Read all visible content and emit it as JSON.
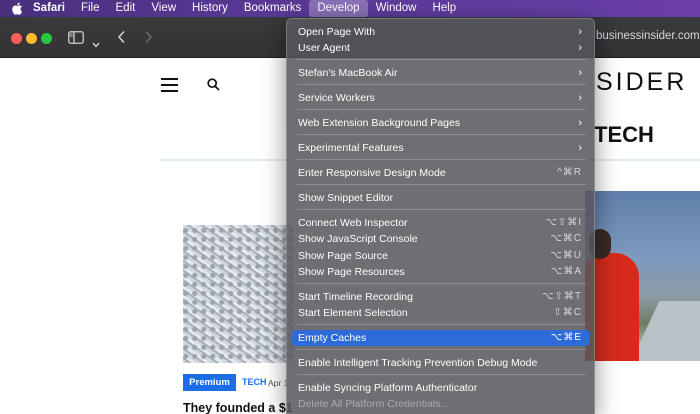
{
  "menubar": {
    "apple_icon": "apple-logo-icon",
    "items": [
      "Safari",
      "File",
      "Edit",
      "View",
      "History",
      "Bookmarks",
      "Develop",
      "Window",
      "Help"
    ],
    "active": "Develop"
  },
  "toolbar": {
    "icons": [
      "sidebar-icon",
      "chevron-down-icon",
      "back-icon",
      "forward-icon"
    ],
    "url_fragment": "businessinsider.com"
  },
  "page": {
    "logo_fragment": "SIDER",
    "section_fragment": "TECH",
    "badge": "Premium",
    "tag": "TECH",
    "date_fragment": "Apr 1",
    "headline_fragment": "They founded a $1"
  },
  "develop_menu": {
    "items": [
      {
        "label": "Open Page With",
        "submenu": true
      },
      {
        "label": "User Agent",
        "submenu": true
      },
      {
        "label": "Stefan's MacBook Air",
        "submenu": true
      },
      {
        "label": "Service Workers",
        "submenu": true
      },
      {
        "label": "Web Extension Background Pages",
        "submenu": true
      },
      {
        "label": "Experimental Features",
        "submenu": true
      },
      {
        "label": "Enter Responsive Design Mode",
        "shortcut": "^⌘R"
      },
      {
        "label": "Show Snippet Editor"
      },
      {
        "label": "Connect Web Inspector",
        "shortcut": "⌥⇧⌘I"
      },
      {
        "label": "Show JavaScript Console",
        "shortcut": "⌥⌘C"
      },
      {
        "label": "Show Page Source",
        "shortcut": "⌥⌘U"
      },
      {
        "label": "Show Page Resources",
        "shortcut": "⌥⌘A"
      },
      {
        "label": "Start Timeline Recording",
        "shortcut": "⌥⇧⌘T"
      },
      {
        "label": "Start Element Selection",
        "shortcut": "⇧⌘C"
      },
      {
        "label": "Empty Caches",
        "shortcut": "⌥⌘E",
        "highlighted": true
      },
      {
        "label": "Enable Intelligent Tracking Prevention Debug Mode"
      },
      {
        "label": "Enable Syncing Platform Authenticator"
      },
      {
        "label": "Delete All Platform Credentials...",
        "disabled": true
      }
    ]
  },
  "colors": {
    "menubar": "#5b3a99",
    "highlight": "#2f6bd8",
    "brand_blue": "#1c6ee8"
  }
}
